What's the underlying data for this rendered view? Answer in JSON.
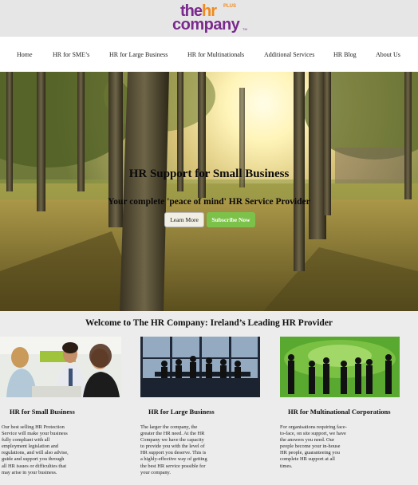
{
  "logo": {
    "the": "the",
    "hr": "hr",
    "plus": "PLUS",
    "company": "company",
    "tm": "TM"
  },
  "nav": {
    "items": [
      {
        "label": "Home"
      },
      {
        "label": "HR for SME’s"
      },
      {
        "label": "HR for Large Business"
      },
      {
        "label": "HR for Multinationals"
      },
      {
        "label": "Additional Services"
      },
      {
        "label": "HR Blog"
      },
      {
        "label": "About Us"
      }
    ]
  },
  "hero": {
    "title": "HR Support for Small Business",
    "subtitle": "Your complete 'peace of mind' HR Service Provider",
    "learn_more": "Learn More",
    "subscribe": "Subscribe Now"
  },
  "welcome": "Welcome to The HR Company: Ireland’s Leading HR Provider",
  "cards": [
    {
      "title": "HR for Small Business",
      "lines": [
        "Our best selling HR Protection",
        "Service will make your business",
        "fully compliant with all",
        "employment legislation and",
        "regulations, and will also advise,",
        "guide and support you through",
        "all HR issues or difficulties that",
        "may arise in your business."
      ]
    },
    {
      "title": "HR for Large Business",
      "lines": [
        "The larger the company, the",
        "greater the HR need. At the HR",
        "Company we have the capacity",
        "to provide you with the level of",
        "HR support you deserve. This is",
        "a highly-effective way of getting",
        "the best HR service possible for",
        "your company."
      ]
    },
    {
      "title": "HR for Multinational Corporations",
      "lines": [
        "For organisations requiring face-",
        "to-face, on site support, we have",
        "the answers you need. Our",
        "people become your in-house",
        "HR people, guaranteeing you",
        "complete HR support at all",
        "times."
      ]
    }
  ],
  "colors": {
    "brand_purple": "#7a2a8c",
    "brand_orange": "#f08a1c",
    "subscribe_green": "#7cc24a"
  }
}
